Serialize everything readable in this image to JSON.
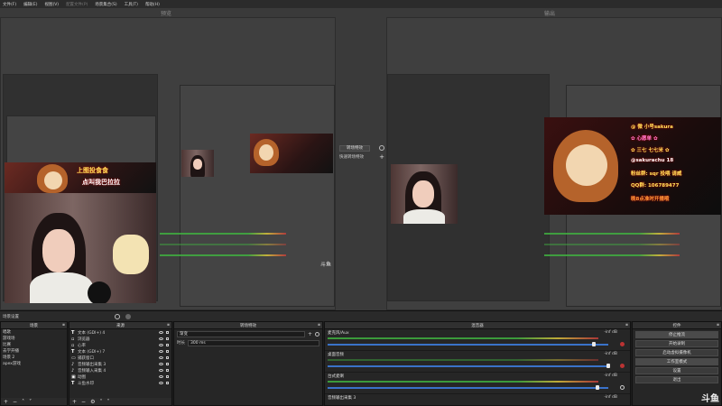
{
  "menu": [
    {
      "label": "文件(F)",
      "enabled": true
    },
    {
      "label": "编辑(E)",
      "enabled": true
    },
    {
      "label": "视图(V)",
      "enabled": true
    },
    {
      "label": "配置文件(P)",
      "enabled": false
    },
    {
      "label": "场景集合(S)",
      "enabled": true
    },
    {
      "label": "工具(T)",
      "enabled": true
    },
    {
      "label": "帮助(H)",
      "enabled": true
    }
  ],
  "preview": {
    "title": "预览"
  },
  "program": {
    "title": "输出"
  },
  "transition_panel": {
    "button": "转场特效",
    "quick_label": "快速转场特效"
  },
  "overlay": {
    "left_caption_1": "上图投食食",
    "left_caption_2": "点叫我巴拉拉",
    "right_lines": [
      "@ 微 小号sakura",
      "✿ 心愿单 ✿",
      "✿ 三七 七七米 ✿",
      "@sakurachu 18",
      "粉丝群: sqr 投喂 请威",
      "QQ群: 106789477",
      "晚8点准时开播哦"
    ]
  },
  "watermark_small": "斗鱼",
  "scene_bar": {
    "label": "场景设置",
    "icons": [
      "settings-icon",
      "record-icon"
    ]
  },
  "scenes": {
    "title": "场景",
    "items": [
      "唱歌",
      "游戏场",
      "比赛",
      "去学开播",
      "场景 2",
      "apex游戏"
    ],
    "selected": -1
  },
  "sources": {
    "title": "来源",
    "items": [
      {
        "label": "文本 (GDI+) 4",
        "type": "T"
      },
      {
        "label": "浏览器",
        "type": "img"
      },
      {
        "label": "心率",
        "type": "img"
      },
      {
        "label": "文本 (GDI+) 7",
        "type": "T"
      },
      {
        "label": "捕获窗口",
        "type": "img"
      },
      {
        "label": "音频输出采集 3",
        "type": "img"
      },
      {
        "label": "音频输入采集 4",
        "type": "img"
      },
      {
        "label": "动图",
        "type": "img"
      },
      {
        "label": "斗鱼水印",
        "type": "T"
      }
    ]
  },
  "transitions": {
    "title": "转场特效",
    "type_value": "渐变",
    "duration_label": "时长",
    "duration_value": "300 ms"
  },
  "mixer": {
    "title": "混音器",
    "tracks": [
      {
        "name": "麦克风/Aux",
        "db": "-inf dB",
        "level": 0.95
      },
      {
        "name": "桌面音频",
        "db": "-inf dB",
        "level": 1.0
      },
      {
        "name": "台式麦喇",
        "db": "-inf dB",
        "level": 0.96
      },
      {
        "name": "音频输出采集 3",
        "db": "-inf dB",
        "level": 0.5
      }
    ]
  },
  "controls": {
    "title": "控件",
    "buttons": [
      "停止推流",
      "开始录制",
      "启动虚拟摄像机",
      "工作室模式",
      "设置",
      "退出"
    ],
    "active": [
      0,
      3
    ]
  },
  "brand": "斗鱼"
}
